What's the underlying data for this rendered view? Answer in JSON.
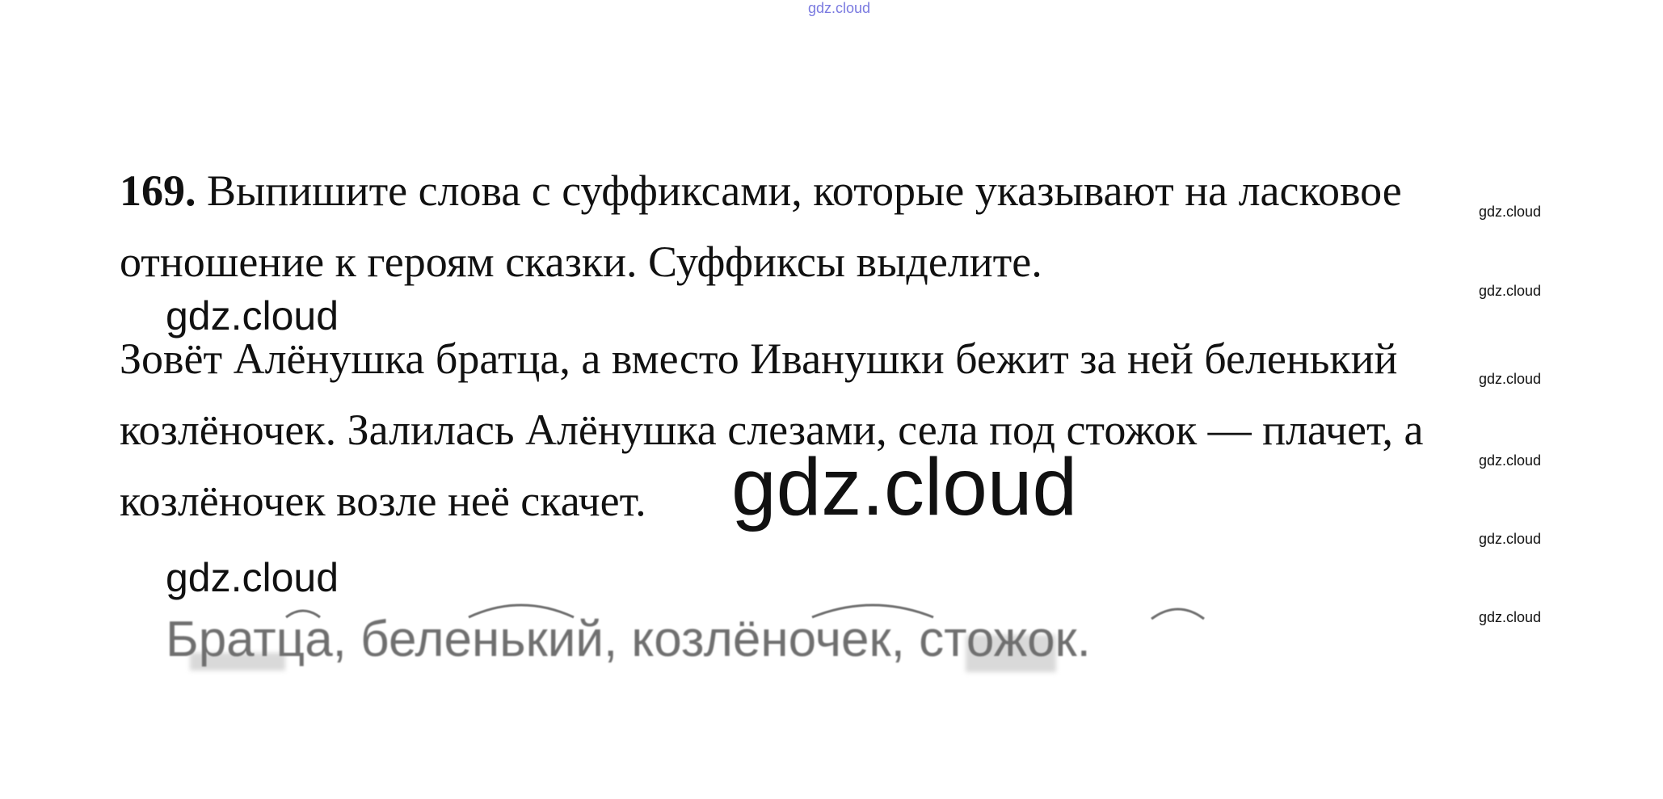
{
  "watermark": "gdz.cloud",
  "task": {
    "number": "169.",
    "line1": "Выпишите слова с суффиксами, которые указывают на ласковое",
    "line2": "отношение к героям сказки. Суффиксы выделите."
  },
  "story": {
    "line1": "Зовёт Алёнушка братца, а вместо Иванушки бежит за ней беленький",
    "line2": "козлёночек. Залилась Алёнушка слезами, села под стожок — плачет, а",
    "line3": "козлёночек возле неё скачет."
  },
  "answer": "Братца, беленький, козлёночек, стожок."
}
